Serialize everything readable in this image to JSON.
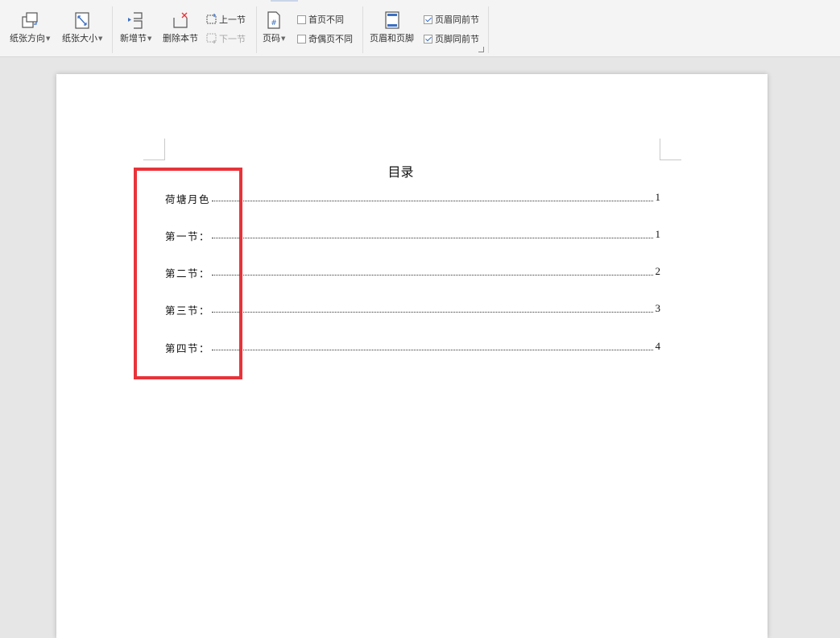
{
  "ribbon": {
    "paper_orientation": "纸张方向",
    "paper_size": "纸张大小",
    "add_section": "新增节",
    "delete_section": "删除本节",
    "prev_section": "上一节",
    "next_section": "下一节",
    "page_number": "页码",
    "first_page_different": "首页不同",
    "odd_even_different": "奇偶页不同",
    "header_footer": "页眉和页脚",
    "header_same_as_prev": "页眉同前节",
    "footer_same_as_prev": "页脚同前节",
    "first_page_different_checked": false,
    "odd_even_different_checked": false,
    "header_same_as_prev_checked": true,
    "footer_same_as_prev_checked": true
  },
  "document": {
    "toc_title": "目录",
    "toc_entries": [
      {
        "name": "荷塘月色",
        "page": "1"
      },
      {
        "name": "第一节：",
        "page": "1"
      },
      {
        "name": "第二节：",
        "page": "2"
      },
      {
        "name": "第三节：",
        "page": "3"
      },
      {
        "name": "第四节：",
        "page": "4"
      }
    ]
  },
  "colors": {
    "highlight": "#e8333a",
    "accent": "#3b6fc4"
  }
}
